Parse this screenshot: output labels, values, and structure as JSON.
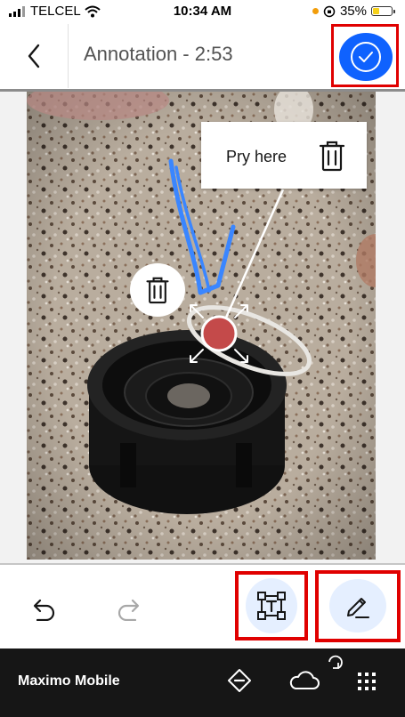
{
  "status_bar": {
    "carrier": "TELCEL",
    "time": "10:34 AM",
    "battery": "35%",
    "battery_color": "#f6d11a",
    "icons": [
      "signal-icon",
      "wifi-icon",
      "location-dot-icon",
      "orientation-lock-icon",
      "battery-icon"
    ]
  },
  "header": {
    "title": "Annotation - 2:53",
    "back_icon": "chevron-left-icon",
    "confirm_icon": "checkmark-icon",
    "accent_color": "#0f62fe"
  },
  "annotation": {
    "callout_text": "Pry here",
    "callout_icon": "trash-icon",
    "shape_delete_icon": "trash-icon",
    "stroke_color": "#3a86ff"
  },
  "toolbar": {
    "undo_icon": "undo-icon",
    "redo_icon": "redo-icon",
    "text_tool_icon": "text-box-icon",
    "pen_tool_icon": "pen-icon",
    "highlight_color": "#e00000"
  },
  "footer": {
    "brand": "Maximo Mobile",
    "icons": [
      "diamond-minus-icon",
      "cloud-sync-icon",
      "app-grid-icon"
    ]
  }
}
